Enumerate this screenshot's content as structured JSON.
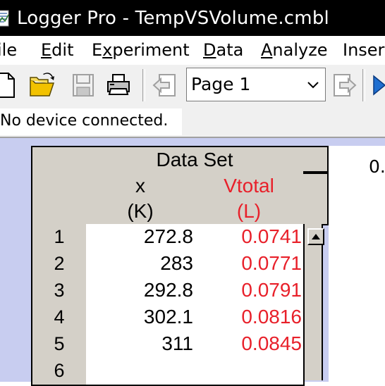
{
  "window": {
    "title": "Logger Pro - TempVSVolume.cmbl"
  },
  "menu": [
    {
      "label": "File",
      "underline_index": 0,
      "visible_text": "ile"
    },
    {
      "label": "Edit",
      "underline_index": 0
    },
    {
      "label": "Experiment",
      "underline_index": 1
    },
    {
      "label": "Data",
      "underline_index": 0
    },
    {
      "label": "Analyze",
      "underline_index": 0
    },
    {
      "label": "Insert",
      "visible_text": "Inser"
    }
  ],
  "menu_labels": {
    "file_rest": "ile",
    "edit_u": "E",
    "edit_rest": "dit",
    "exp_pre": "E",
    "exp_u": "x",
    "exp_rest": "periment",
    "data_u": "D",
    "data_rest": "ata",
    "analyze_u": "A",
    "analyze_rest": "nalyze",
    "insert": "Inser"
  },
  "toolbar": {
    "icons": [
      "new-document-icon",
      "open-folder-icon",
      "save-icon",
      "print-icon",
      "back-page-icon",
      "forward-page-icon",
      "next-icon"
    ],
    "page_select_value": "Page 1"
  },
  "status": {
    "text": "No device connected."
  },
  "table": {
    "dataset_title": "Data Set",
    "columns": [
      {
        "name": "x",
        "unit": "(K)",
        "color": "#000000"
      },
      {
        "name": "Vtotal",
        "unit": "(L)",
        "color": "#e8202a"
      }
    ],
    "row_numbers": [
      "1",
      "2",
      "3",
      "4",
      "5",
      "6"
    ],
    "rows": [
      [
        "272.8",
        "0.0741"
      ],
      [
        "283",
        "0.0771"
      ],
      [
        "292.8",
        "0.0791"
      ],
      [
        "302.1",
        "0.0816"
      ],
      [
        "311",
        "0.0845"
      ],
      [
        "",
        ""
      ]
    ]
  },
  "graph": {
    "partial_label": "0."
  },
  "colors": {
    "titlebar": "#000000",
    "toolbar": "#f0f0f0",
    "workarea": "#c8cdf0",
    "header": "#d4d0c8",
    "red_series": "#e8202a"
  }
}
